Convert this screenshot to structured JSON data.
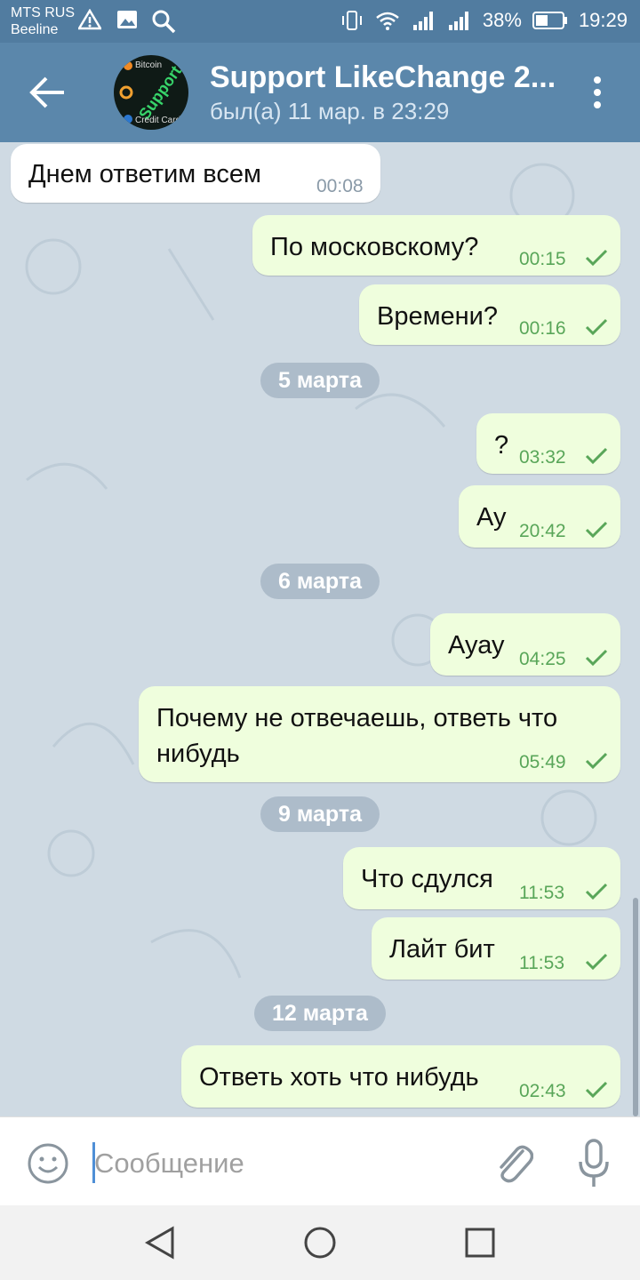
{
  "status_bar": {
    "carrier_line1": "MTS RUS",
    "carrier_line2": "Beeline",
    "battery": "38%",
    "time": "19:29",
    "icons": [
      "warning-icon",
      "image-icon",
      "search-icon",
      "vibrate-icon",
      "wifi-icon",
      "signal-icon",
      "signal-icon",
      "battery-icon"
    ]
  },
  "header": {
    "title": "Support LikeChange 2...",
    "status": "был(а) 11 мар. в 23:29",
    "avatar_labels": [
      "Bitcoin",
      "Support",
      "Credit Card"
    ]
  },
  "messages": [
    {
      "dir": "in",
      "text": "Днем ответим всем",
      "time": "00:08"
    },
    {
      "dir": "out",
      "text": "По московскому?",
      "time": "00:15"
    },
    {
      "dir": "out",
      "text": "Времени?",
      "time": "00:16"
    },
    {
      "date": "5 марта"
    },
    {
      "dir": "out",
      "text": "?",
      "time": "03:32"
    },
    {
      "dir": "out",
      "text": "Ау",
      "time": "20:42"
    },
    {
      "date": "6 марта"
    },
    {
      "dir": "out",
      "text": "Ауау",
      "time": "04:25"
    },
    {
      "dir": "out",
      "text": "Почему не отвечаешь, ответь что нибудь",
      "time": "05:49"
    },
    {
      "date": "9 марта"
    },
    {
      "dir": "out",
      "text": "Что сдулся",
      "time": "11:53"
    },
    {
      "dir": "out",
      "text": "Лайт бит",
      "time": "11:53"
    },
    {
      "date": "12 марта"
    },
    {
      "dir": "out",
      "text": "Ответь хоть что нибудь",
      "time": "02:43"
    }
  ],
  "input": {
    "placeholder": "Сообщение"
  },
  "colors": {
    "header": "#5b87ab",
    "statusbar": "#517ca0",
    "outgoing_bubble": "#effedd",
    "incoming_bubble": "#ffffff",
    "check": "#59a659"
  }
}
